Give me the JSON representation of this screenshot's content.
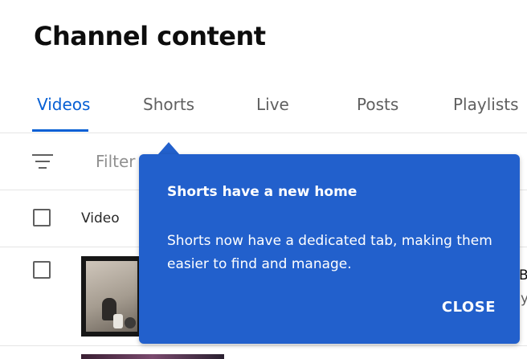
{
  "page": {
    "title": "Channel content"
  },
  "tabs": [
    {
      "label": "Videos",
      "active": true
    },
    {
      "label": "Shorts",
      "active": false
    },
    {
      "label": "Live",
      "active": false
    },
    {
      "label": "Posts",
      "active": false
    },
    {
      "label": "Playlists",
      "active": false
    }
  ],
  "filter": {
    "label": "Filter",
    "icon": "filter-lines-icon"
  },
  "table": {
    "columns": [
      "Video"
    ],
    "rows": [
      {
        "thumbnail": "video-thumbnail",
        "edge_text": [
          "B",
          "y"
        ]
      }
    ]
  },
  "tooltip": {
    "title": "Shorts have a new home",
    "body": "Shorts now have a dedicated tab, making them easier to find and manage.",
    "close_label": "CLOSE"
  },
  "colors": {
    "accent": "#065fd4",
    "tooltip_bg": "#2260cc",
    "tab_inactive": "#606060",
    "divider": "#e5e5e5"
  }
}
